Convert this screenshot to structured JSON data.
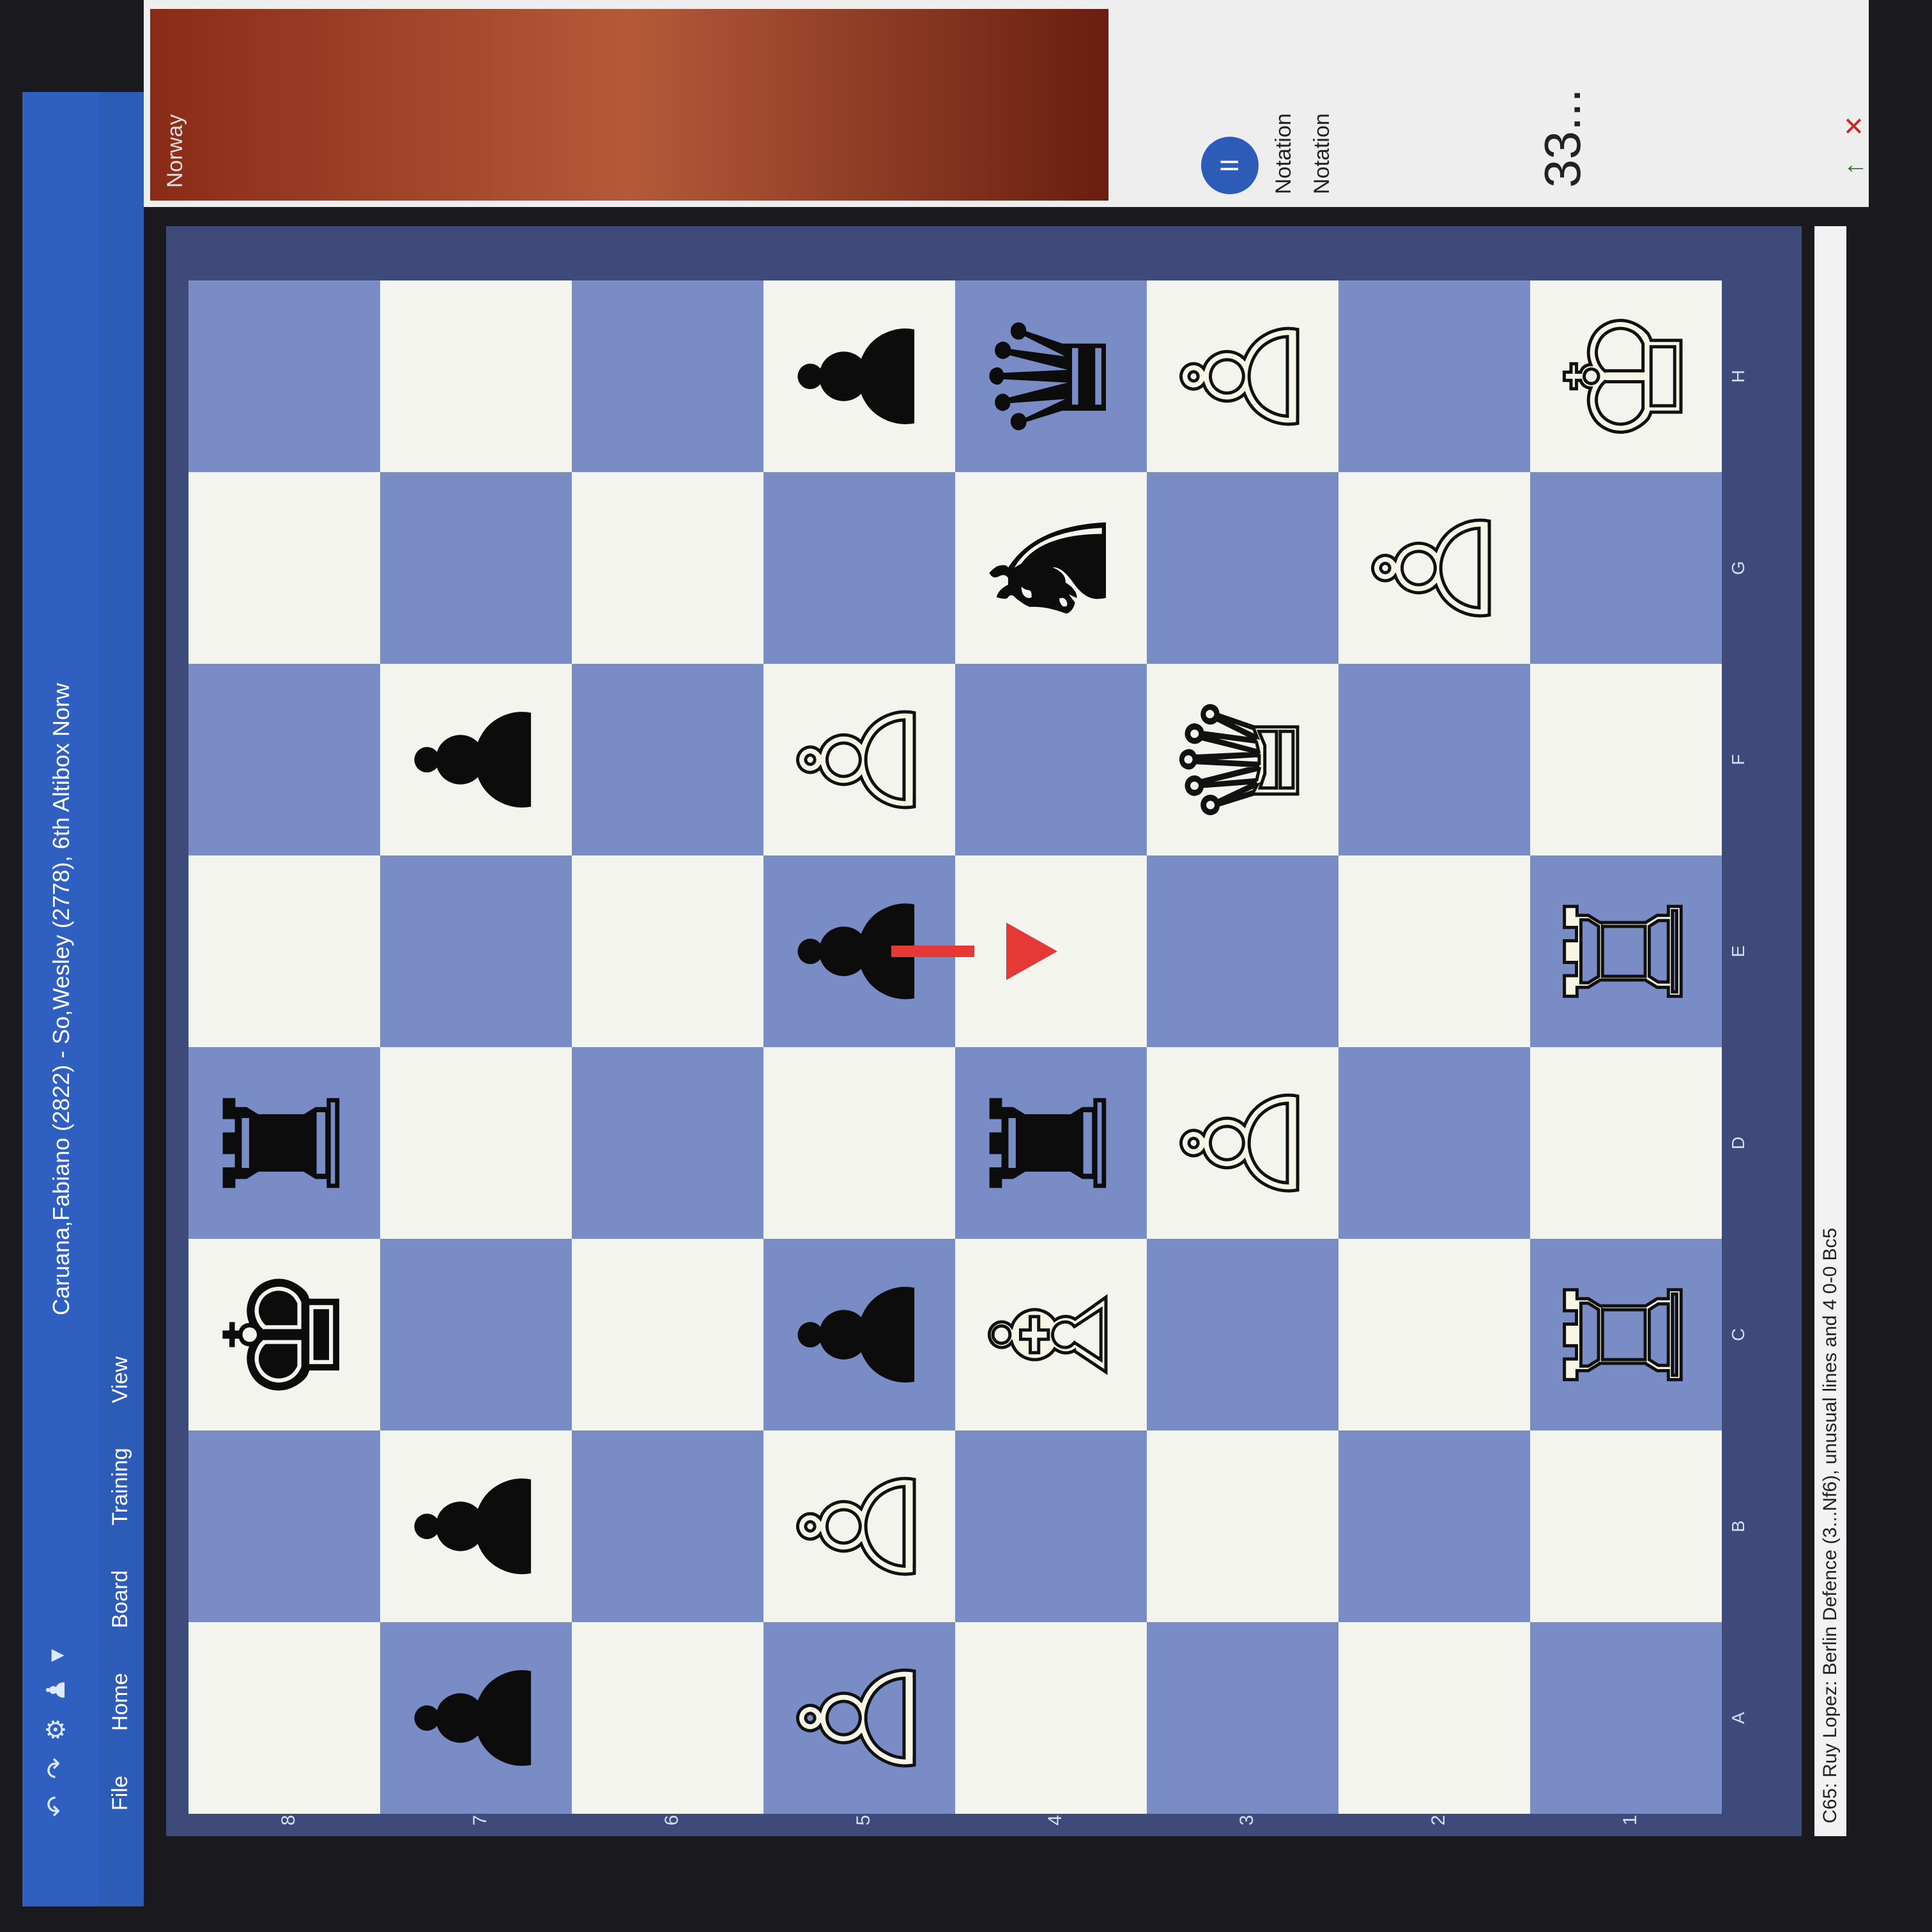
{
  "window": {
    "title": "Caruana,Fabiano (2822) - So,Wesley (2778), 6th Altibox Norw",
    "quick_access": [
      "↶",
      "↷",
      "⚙",
      "♟",
      "▾"
    ]
  },
  "menu": [
    "File",
    "Home",
    "Board",
    "Training",
    "View"
  ],
  "board": {
    "files": [
      "A",
      "B",
      "C",
      "D",
      "E",
      "F",
      "G",
      "H"
    ],
    "ranks": [
      "8",
      "7",
      "6",
      "5",
      "4",
      "3",
      "2",
      "1"
    ],
    "pieces": [
      {
        "sq": "c8",
        "glyph": "♚",
        "side": "b",
        "name": "black-king"
      },
      {
        "sq": "d8",
        "glyph": "♜",
        "side": "b",
        "name": "black-rook"
      },
      {
        "sq": "a7",
        "glyph": "♟",
        "side": "b",
        "name": "black-pawn"
      },
      {
        "sq": "b7",
        "glyph": "♟",
        "side": "b",
        "name": "black-pawn"
      },
      {
        "sq": "f7",
        "glyph": "♟",
        "side": "b",
        "name": "black-pawn"
      },
      {
        "sq": "a5",
        "glyph": "♙",
        "side": "w",
        "name": "white-pawn"
      },
      {
        "sq": "b5",
        "glyph": "♙",
        "side": "w",
        "name": "white-pawn"
      },
      {
        "sq": "c5",
        "glyph": "♟",
        "side": "b",
        "name": "black-pawn"
      },
      {
        "sq": "e5",
        "glyph": "♟",
        "side": "b",
        "name": "black-pawn"
      },
      {
        "sq": "f5",
        "glyph": "♙",
        "side": "w",
        "name": "white-pawn"
      },
      {
        "sq": "h5",
        "glyph": "♟",
        "side": "b",
        "name": "black-pawn"
      },
      {
        "sq": "c4",
        "glyph": "♗",
        "side": "w",
        "name": "white-bishop"
      },
      {
        "sq": "d4",
        "glyph": "♜",
        "side": "b",
        "name": "black-rook"
      },
      {
        "sq": "g4",
        "glyph": "♞",
        "side": "b",
        "name": "black-knight"
      },
      {
        "sq": "h4",
        "glyph": "♛",
        "side": "b",
        "name": "black-queen"
      },
      {
        "sq": "d3",
        "glyph": "♙",
        "side": "w",
        "name": "white-pawn"
      },
      {
        "sq": "f3",
        "glyph": "♕",
        "side": "w",
        "name": "white-queen"
      },
      {
        "sq": "h3",
        "glyph": "♙",
        "side": "w",
        "name": "white-pawn"
      },
      {
        "sq": "g2",
        "glyph": "♙",
        "side": "w",
        "name": "white-pawn"
      },
      {
        "sq": "c1",
        "glyph": "♖",
        "side": "w",
        "name": "white-rook"
      },
      {
        "sq": "e1",
        "glyph": "♖",
        "side": "w",
        "name": "white-rook"
      },
      {
        "sq": "h1",
        "glyph": "♔",
        "side": "w",
        "name": "white-king"
      }
    ],
    "arrow": {
      "from": "e5",
      "to": "e4",
      "color": "#e53935"
    },
    "light_color": "#f3f4ee",
    "dark_color": "#7a8cc6"
  },
  "status": "C65: Ruy Lopez: Berlin Defence (3...Nf6), unusual lines and 4 0-0 Bc5",
  "panel": {
    "country": "Norway",
    "pause": "II",
    "notation_tab_1": "Notation",
    "notation_tab_2": "Notation",
    "current_move": "33...",
    "tools": [
      "↑",
      "✕"
    ]
  }
}
